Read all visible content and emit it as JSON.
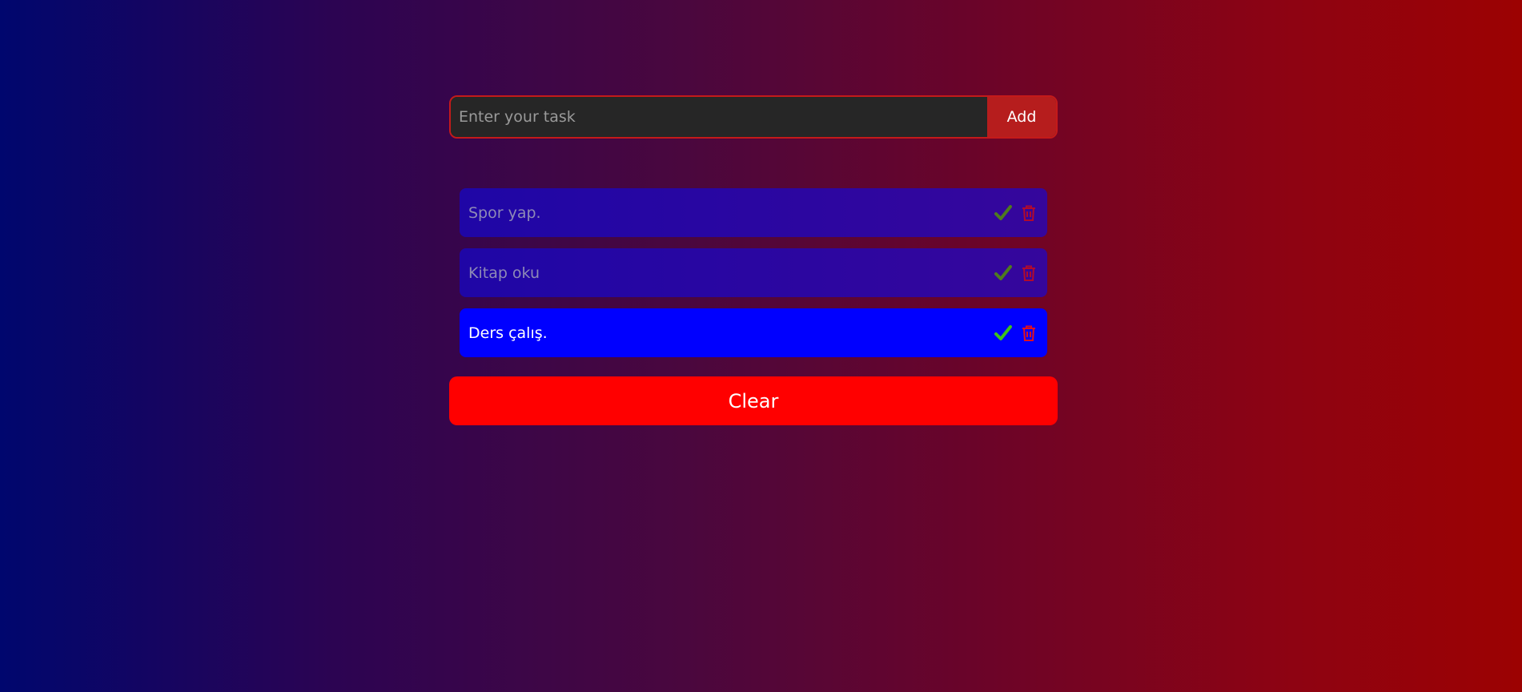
{
  "input": {
    "placeholder": "Enter your task",
    "value": ""
  },
  "add_button": {
    "label": "Add"
  },
  "tasks": [
    {
      "text": "Spor yap.",
      "completed": true
    },
    {
      "text": "Kitap oku",
      "completed": true
    },
    {
      "text": "Ders çalış.",
      "completed": false
    }
  ],
  "clear_button": {
    "label": "Clear"
  },
  "icons": {
    "complete": "check-icon",
    "delete": "trash-icon"
  },
  "colors": {
    "check_done": "#4e7a1e",
    "check_active": "#3ec21c",
    "trash_done": "#b00a2e",
    "trash_active": "#e01020",
    "accent": "#ff0000",
    "item_active": "#0000ff"
  }
}
